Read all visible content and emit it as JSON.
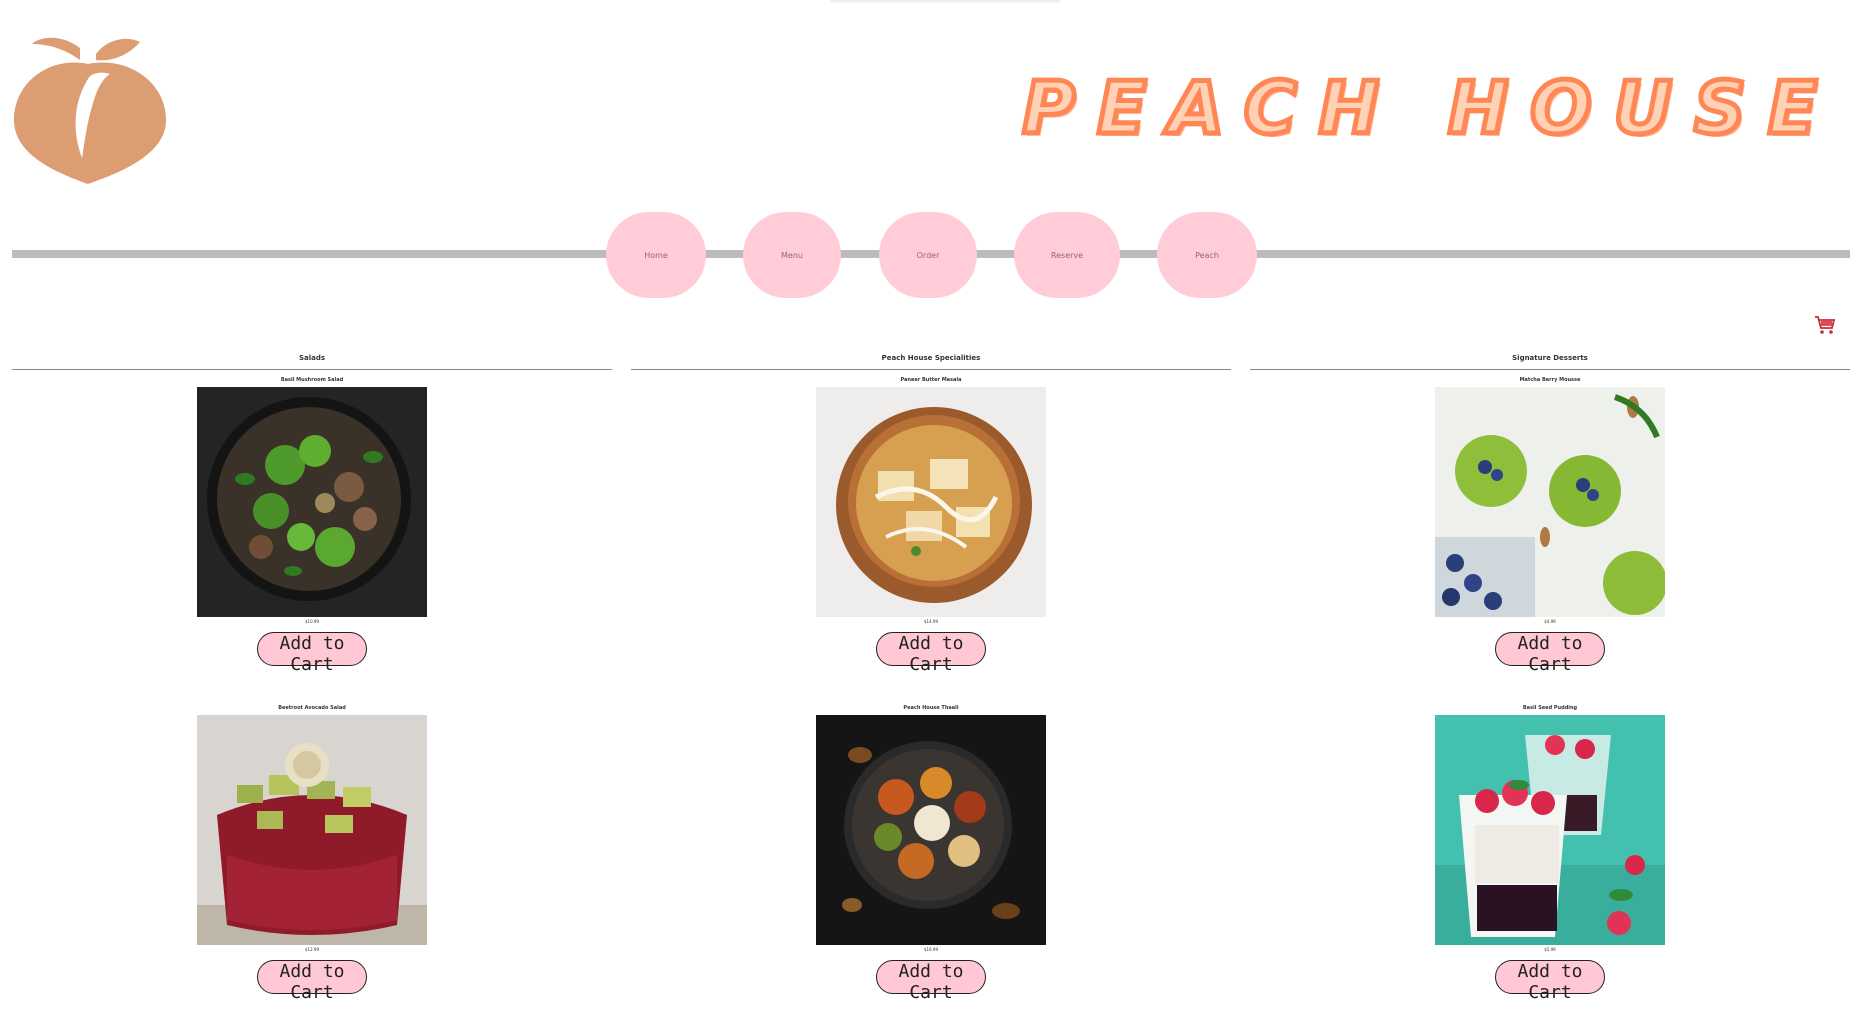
{
  "brand": {
    "name": "PEACH HOUSE",
    "color": "#ff8755",
    "logo_color": "#dd9d72"
  },
  "nav": {
    "items": [
      {
        "label": "Home"
      },
      {
        "label": "Menu"
      },
      {
        "label": "Order"
      },
      {
        "label": "Reserve"
      },
      {
        "label": "Peach"
      }
    ],
    "button_color": "#ffccd8"
  },
  "cart": {
    "icon": "shopping-cart-icon"
  },
  "sections": [
    {
      "title": "Salads",
      "items": [
        {
          "name": "Basil Mushroom Salad",
          "price": "$10.99",
          "button": "Add to Cart"
        },
        {
          "name": "Beetroot Avocado Salad",
          "price": "$12.99",
          "button": "Add to Cart"
        }
      ]
    },
    {
      "title": "Peach House Specialities",
      "items": [
        {
          "name": "Paneer Butter Masala",
          "price": "$14.99",
          "button": "Add to Cart"
        },
        {
          "name": "Peach House Thaali",
          "price": "$16.99",
          "button": "Add to Cart"
        }
      ]
    },
    {
      "title": "Signature Desserts",
      "items": [
        {
          "name": "Matcha Berry Mousse",
          "price": "$4.99",
          "button": "Add to Cart"
        },
        {
          "name": "Basil Seed Pudding",
          "price": "$5.99",
          "button": "Add to Cart"
        }
      ]
    }
  ]
}
